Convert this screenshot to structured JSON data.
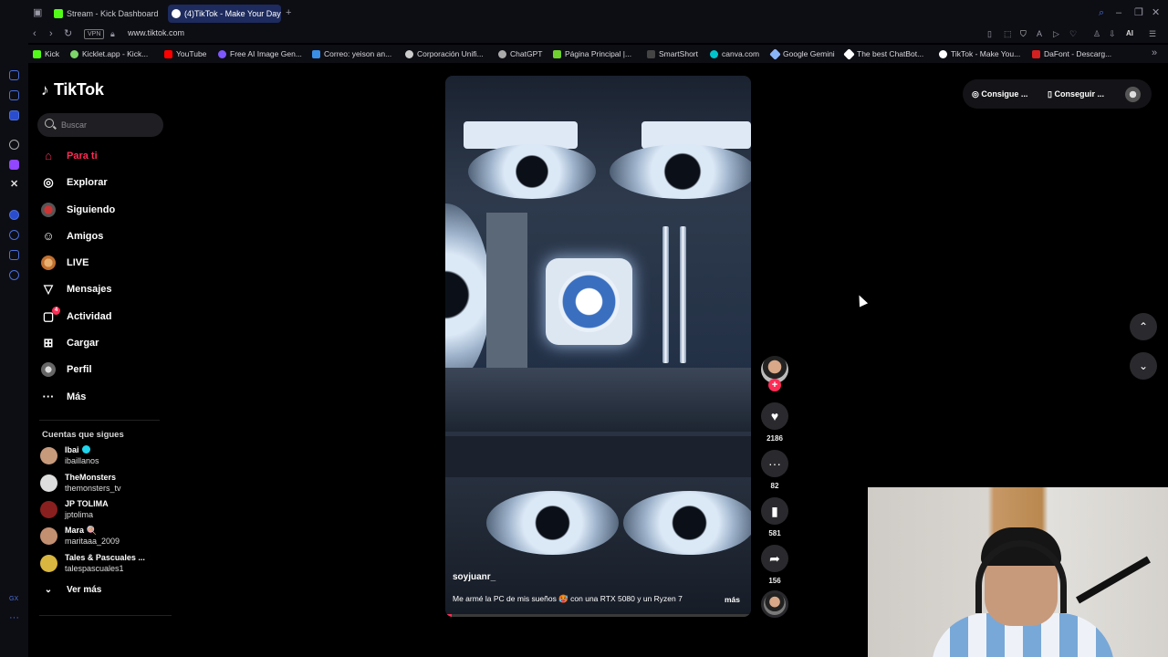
{
  "browser": {
    "tabs": [
      {
        "label": "Stream - Kick Dashboard",
        "color": "#53fc18"
      },
      {
        "label": "(4)TikTok - Make Your Day",
        "color": "#ffffff",
        "active": true
      }
    ],
    "address": "www.tiktok.com",
    "vpn_label": "VPN",
    "ai_label": "AI",
    "bookmarks": [
      {
        "label": "Kick",
        "color": "#53fc18"
      },
      {
        "label": "Kicklet.app - Kick...",
        "color": "#7cd66a"
      },
      {
        "label": "YouTube",
        "color": "#ff0000"
      },
      {
        "label": "Free AI Image Gen...",
        "color": "#7e57ff"
      },
      {
        "label": "Correo: yeison an...",
        "color": "#3a8ee6"
      },
      {
        "label": "Corporación Unifi...",
        "color": "#cccccc"
      },
      {
        "label": "ChatGPT",
        "color": "#aaaaaa"
      },
      {
        "label": "Página Principal |...",
        "color": "#6fd12e"
      },
      {
        "label": "SmartShort",
        "color": "#444444"
      },
      {
        "label": "canva.com",
        "color": "#00c4cc"
      },
      {
        "label": "Google Gemini",
        "color": "#8ab4f8"
      },
      {
        "label": "The best ChatBot...",
        "color": "#ffffff"
      },
      {
        "label": "TikTok - Make You...",
        "color": "#ffffff"
      },
      {
        "label": "DaFont - Descarg...",
        "color": "#d42020"
      }
    ]
  },
  "tiktok": {
    "logo": "TikTok",
    "search_placeholder": "Buscar",
    "nav": [
      {
        "label": "Para ti",
        "icon": "home-icon",
        "glyph": "⌂",
        "active": true
      },
      {
        "label": "Explorar",
        "icon": "compass-icon",
        "glyph": "◎"
      },
      {
        "label": "Siguiendo",
        "icon": "avatar",
        "glyph": ""
      },
      {
        "label": "Amigos",
        "icon": "friends-icon",
        "glyph": "☺"
      },
      {
        "label": "LIVE",
        "icon": "live-avatar",
        "glyph": ""
      },
      {
        "label": "Mensajes",
        "icon": "send-icon",
        "glyph": "▽"
      },
      {
        "label": "Actividad",
        "icon": "activity-icon",
        "glyph": "▢",
        "badge": "4"
      },
      {
        "label": "Cargar",
        "icon": "upload-icon",
        "glyph": "⊞"
      },
      {
        "label": "Perfil",
        "icon": "profile-avatar",
        "glyph": ""
      },
      {
        "label": "Más",
        "icon": "more-icon",
        "glyph": "···"
      }
    ],
    "following_title": "Cuentas que sigues",
    "following": [
      {
        "name": "Ibai",
        "handle": "ibaillanos",
        "verified": true,
        "color": "#c79a7c"
      },
      {
        "name": "TheMonsters",
        "handle": "themonsters_tv",
        "color": "#ddd"
      },
      {
        "name": "JP TOLIMA",
        "handle": "jptolima",
        "color": "#8a1f1f"
      },
      {
        "name": "Mara 🍭",
        "handle": "maritaaa_2009",
        "color": "#c38f71"
      },
      {
        "name": "Tales & Pascuales ...",
        "handle": "talespascuales1",
        "color": "#d8b640"
      }
    ],
    "see_more": "Ver más",
    "video": {
      "username": "soyjuanr_",
      "description": "Me armé la PC de mis sueños 🥵 con una RTX 5080 y un Ryzen 7",
      "more": "más",
      "progress": 0.02
    },
    "actions": {
      "likes": "2186",
      "comments": "82",
      "saves": "581",
      "shares": "156"
    },
    "top_right": {
      "coins": "Consigue ...",
      "app": "Conseguir ..."
    }
  }
}
